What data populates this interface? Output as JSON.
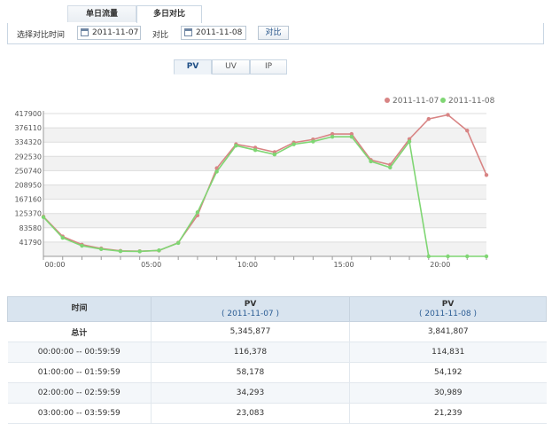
{
  "top_tabs": [
    {
      "label": "单日流量",
      "active": false
    },
    {
      "label": "多日对比",
      "active": true
    }
  ],
  "filter": {
    "label": "选择对比时间",
    "date1": "2011-11-07",
    "vs_label": "对比",
    "date2": "2011-11-08",
    "compare_button": "对比"
  },
  "metric_tabs": [
    {
      "label": "PV",
      "active": true
    },
    {
      "label": "UV",
      "active": false
    },
    {
      "label": "IP",
      "active": false
    }
  ],
  "colors": {
    "series1": "#d88484",
    "series2": "#7fd673"
  },
  "chart_data": {
    "type": "line",
    "x": [
      "00:00",
      "01:00",
      "02:00",
      "03:00",
      "04:00",
      "05:00",
      "06:00",
      "07:00",
      "08:00",
      "09:00",
      "10:00",
      "11:00",
      "12:00",
      "13:00",
      "14:00",
      "15:00",
      "16:00",
      "17:00",
      "18:00",
      "19:00",
      "20:00",
      "21:00",
      "22:00",
      "23:00"
    ],
    "x_tick_labels": [
      "00:00",
      "05:00",
      "10:00",
      "15:00",
      "20:00"
    ],
    "y_tick_labels": [
      "417900",
      "376110",
      "334320",
      "292530",
      "250740",
      "208950",
      "167160",
      "125370",
      "83580",
      "41790"
    ],
    "ylim": [
      0,
      417900
    ],
    "grid": "horizontal",
    "legend_position": "top-right",
    "series": [
      {
        "name": "2011-11-07",
        "color": "#d88484",
        "values": [
          116378,
          58178,
          34293,
          23083,
          16000,
          15000,
          17000,
          40000,
          120000,
          258000,
          328000,
          318000,
          305000,
          333000,
          342000,
          358000,
          358000,
          282000,
          268000,
          343000,
          402000,
          414000,
          368000,
          238000
        ]
      },
      {
        "name": "2011-11-08",
        "color": "#7fd673",
        "values": [
          114831,
          54192,
          30989,
          21239,
          15000,
          14500,
          17500,
          39000,
          129000,
          248000,
          324000,
          311000,
          298000,
          328000,
          336000,
          350000,
          350000,
          278000,
          260000,
          336000,
          0,
          0,
          0,
          0
        ]
      }
    ]
  },
  "table": {
    "headers": [
      {
        "title": "时间",
        "sub": ""
      },
      {
        "title": "PV",
        "sub": "( 2011-11-07 )"
      },
      {
        "title": "PV",
        "sub": "( 2011-11-08 )"
      }
    ],
    "rows": [
      {
        "time": "总计",
        "v1": "5,345,877",
        "v2": "3,841,807"
      },
      {
        "time": "00:00:00 -- 00:59:59",
        "v1": "116,378",
        "v2": "114,831"
      },
      {
        "time": "01:00:00 -- 01:59:59",
        "v1": "58,178",
        "v2": "54,192"
      },
      {
        "time": "02:00:00 -- 02:59:59",
        "v1": "34,293",
        "v2": "30,989"
      },
      {
        "time": "03:00:00 -- 03:59:59",
        "v1": "23,083",
        "v2": "21,239"
      }
    ]
  }
}
